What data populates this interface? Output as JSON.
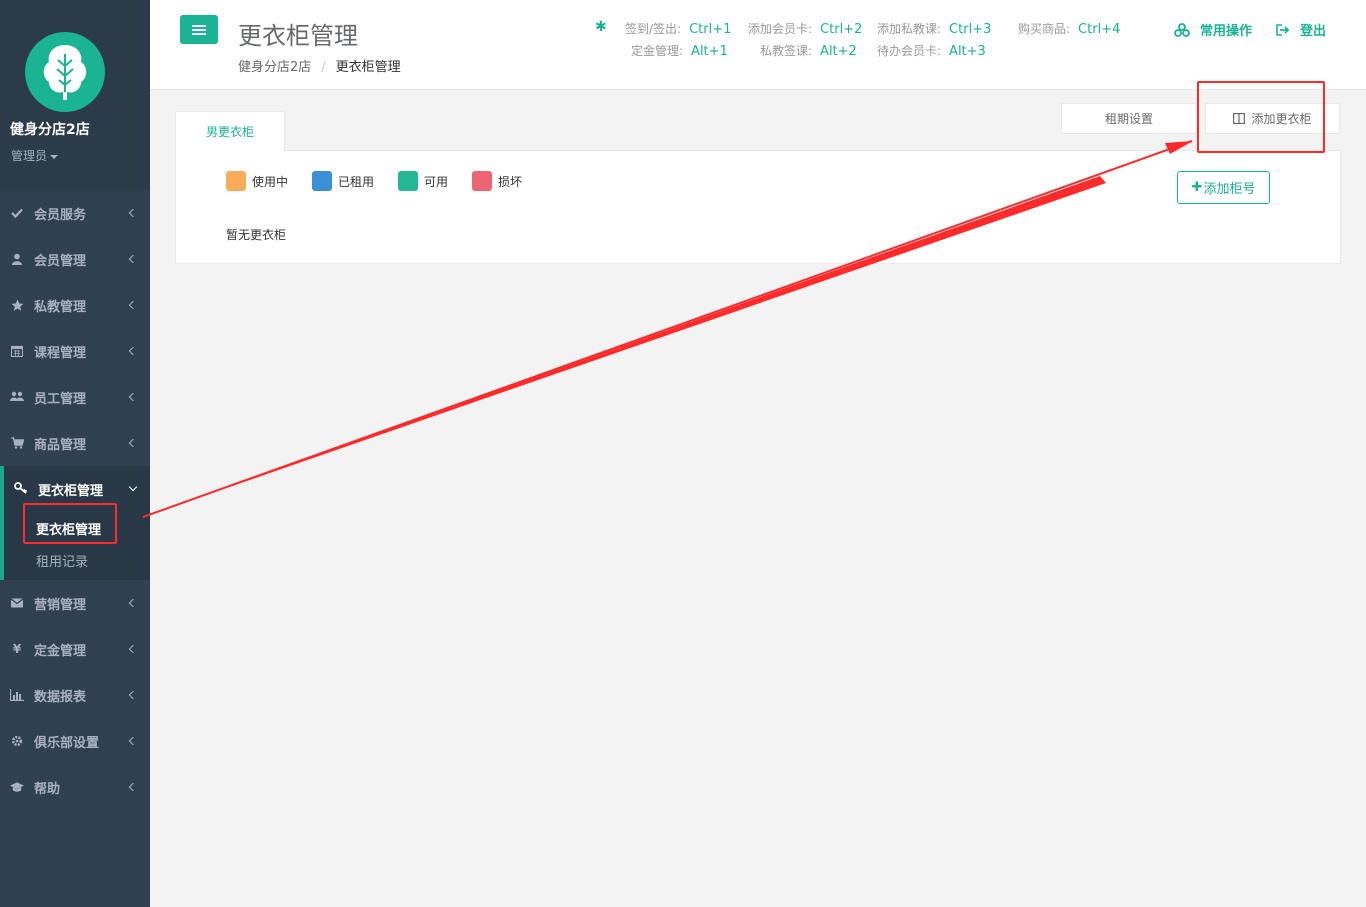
{
  "sidebar": {
    "store_name": "健身分店2店",
    "role": "管理员",
    "items": [
      {
        "label": "会员服务",
        "icon": "check-icon"
      },
      {
        "label": "会员管理",
        "icon": "user-icon"
      },
      {
        "label": "私教管理",
        "icon": "star-icon"
      },
      {
        "label": "课程管理",
        "icon": "calendar-icon"
      },
      {
        "label": "员工管理",
        "icon": "users-icon"
      },
      {
        "label": "商品管理",
        "icon": "cart-icon"
      }
    ],
    "active": {
      "label": "更衣柜管理",
      "icon": "key-icon",
      "children": [
        "更衣柜管理",
        "租用记录"
      ]
    },
    "items_after": [
      {
        "label": "营销管理",
        "icon": "envelope-icon"
      },
      {
        "label": "定金管理",
        "icon": "yen-icon"
      },
      {
        "label": "数据报表",
        "icon": "bar-chart-icon"
      },
      {
        "label": "俱乐部设置",
        "icon": "gear-icon"
      },
      {
        "label": "帮助",
        "icon": "graduation-cap-icon"
      }
    ]
  },
  "header": {
    "title": "更衣柜管理",
    "breadcrumb": [
      "健身分店2店",
      "更衣柜管理"
    ],
    "shortcuts": [
      {
        "label": "签到/签出:",
        "key": "Ctrl+1"
      },
      {
        "label": "添加会员卡:",
        "key": "Ctrl+2"
      },
      {
        "label": "添加私教课:",
        "key": "Ctrl+3"
      },
      {
        "label": "购买商品:",
        "key": "Ctrl+4"
      },
      {
        "label": "定金管理:",
        "key": "Alt+1"
      },
      {
        "label": "私教签课:",
        "key": "Alt+2"
      },
      {
        "label": "待办会员卡:",
        "key": "Alt+3"
      }
    ],
    "common_ops": "常用操作",
    "logout": "登出"
  },
  "main": {
    "tab": "男更衣柜",
    "lease_settings": "租期设置",
    "add_locker": "添加更衣柜",
    "add_number": "添加柜号",
    "legend": [
      {
        "label": "使用中",
        "color": "#f8ac59"
      },
      {
        "label": "已租用",
        "color": "#3b8fd6"
      },
      {
        "label": "可用",
        "color": "#23b795"
      },
      {
        "label": "损坏",
        "color": "#ed6474"
      }
    ],
    "empty_text": "暂无更衣柜"
  },
  "colors": {
    "accent": "#1ab394",
    "sidebar": "#2f4050",
    "annotation": "#ff2a2a"
  }
}
